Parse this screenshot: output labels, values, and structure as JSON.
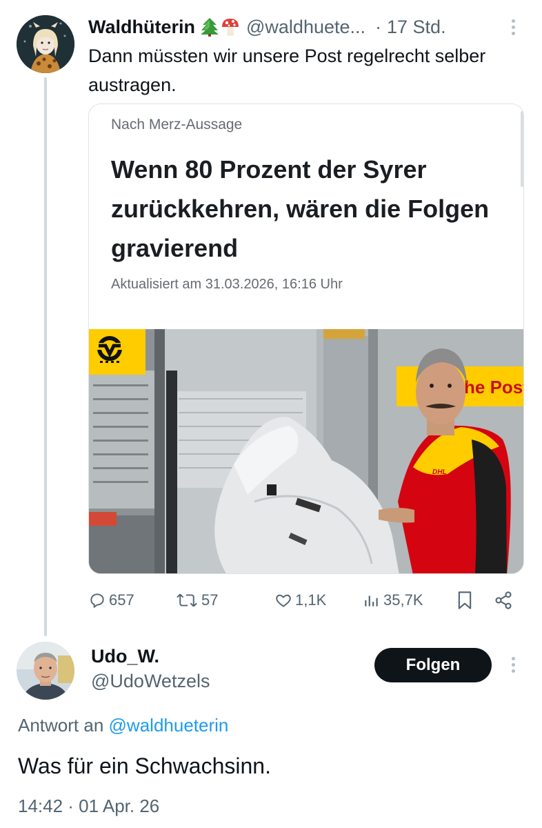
{
  "tweet": {
    "author_name": "Waldhüterin",
    "author_emoji": [
      "evergreen-tree",
      "mushroom"
    ],
    "author_handle": "@waldhuete...",
    "separator": "·",
    "time": "17 Std.",
    "text": "Dann müssten wir unsere Post regelrecht selber austragen.",
    "card": {
      "kicker": "Nach Merz-Aussage",
      "headline": "Wenn 80 Prozent der Syrer zurückkehren, wären die Folgen gravierend",
      "updated": "Aktualisiert am 31.03.2026, 16:16 Uhr",
      "image_sign_text": "he Post",
      "image_shirt_text": "DHL"
    },
    "stats": {
      "replies": "657",
      "reposts": "57",
      "likes": "1,1K",
      "views": "35,7K"
    },
    "icons": [
      "reply-icon",
      "repost-icon",
      "like-icon",
      "views-icon",
      "bookmark-icon",
      "share-icon"
    ]
  },
  "reply": {
    "author_name": "Udo_W.",
    "author_handle": "@UdoWetzels",
    "follow_label": "Folgen",
    "reply_to_prefix": "Antwort an",
    "reply_to_handle": "@waldhueterin",
    "text": "Was für ein Schwachsinn.",
    "timestamp": "14:42 · 01 Apr. 26"
  },
  "colors": {
    "text": "#0f1419",
    "secondary": "#536471",
    "link": "#1d9bf0",
    "button_bg": "#0f1419",
    "thread_line": "#cfd9de",
    "post_yellow": "#ffcc00",
    "dhl_red": "#d40511"
  }
}
